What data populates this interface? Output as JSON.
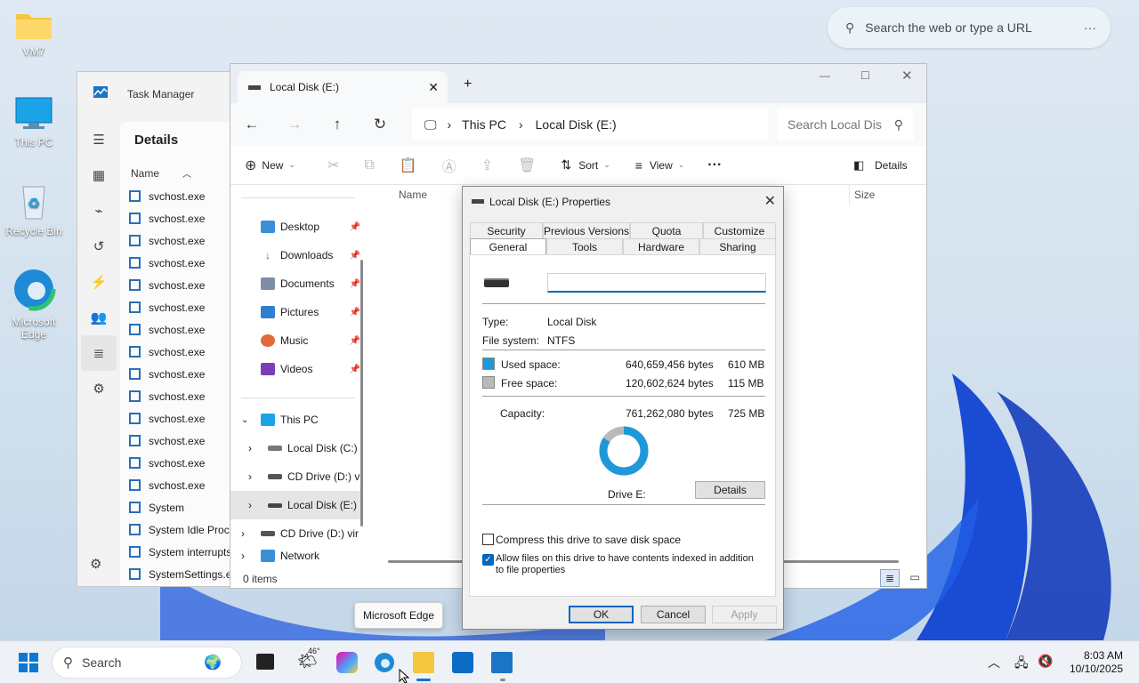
{
  "desktop": {
    "icons": [
      {
        "label": "VM7"
      },
      {
        "label": "This PC"
      },
      {
        "label": "Recycle Bin"
      },
      {
        "label": "Microsoft Edge"
      }
    ]
  },
  "edge_search": {
    "placeholder": "Search the web or type a URL",
    "more": "···"
  },
  "task_manager": {
    "title": "Task Manager",
    "section": "Details",
    "column": "Name",
    "processes": [
      "svchost.exe",
      "svchost.exe",
      "svchost.exe",
      "svchost.exe",
      "svchost.exe",
      "svchost.exe",
      "svchost.exe",
      "svchost.exe",
      "svchost.exe",
      "svchost.exe",
      "svchost.exe",
      "svchost.exe",
      "svchost.exe",
      "svchost.exe",
      "System",
      "System Idle Proce",
      "System interrupts",
      "SystemSettings.ex"
    ]
  },
  "explorer": {
    "tab_title": "Local Disk (E:)",
    "breadcrumb": [
      "This PC",
      "Local Disk (E:)"
    ],
    "search_placeholder": "Search Local Dis",
    "toolbar": {
      "new": "New",
      "sort": "Sort",
      "view": "View",
      "more": "···",
      "details": "Details"
    },
    "quick_access": [
      "Desktop",
      "Downloads",
      "Documents",
      "Pictures",
      "Music",
      "Videos"
    ],
    "this_pc": "This PC",
    "drives": [
      "Local Disk (C:)",
      "CD Drive (D:) v",
      "Local Disk (E:)",
      "CD Drive (D:) vir",
      "Network"
    ],
    "columns": {
      "name": "Name",
      "size": "Size"
    },
    "status": "0 items"
  },
  "properties": {
    "title": "Local Disk (E:) Properties",
    "tabs_row1": [
      "Security",
      "Previous Versions",
      "Quota",
      "Customize"
    ],
    "tabs_row2": [
      "General",
      "Tools",
      "Hardware",
      "Sharing"
    ],
    "name_value": "",
    "type_label": "Type:",
    "type_value": "Local Disk",
    "fs_label": "File system:",
    "fs_value": "NTFS",
    "used_label": "Used space:",
    "used_bytes": "640,659,456 bytes",
    "used_mb": "610 MB",
    "free_label": "Free space:",
    "free_bytes": "120,602,624 bytes",
    "free_mb": "115 MB",
    "cap_label": "Capacity:",
    "cap_bytes": "761,262,080 bytes",
    "cap_mb": "725 MB",
    "used_fraction": 0.84,
    "drive_label": "Drive E:",
    "details_btn": "Details",
    "compress": {
      "label": "Compress this drive to save disk space",
      "checked": false
    },
    "index": {
      "label": "Allow files on this drive to have contents indexed in addition to file properties",
      "checked": true
    },
    "ok": "OK",
    "cancel": "Cancel",
    "apply": "Apply",
    "colors": {
      "used": "#1f98d9",
      "free": "#b9b9b9"
    }
  },
  "tooltip": "Microsoft Edge",
  "taskbar": {
    "search": "Search",
    "weather": "46°",
    "time": "8:03 AM",
    "date": "10/10/2025"
  }
}
